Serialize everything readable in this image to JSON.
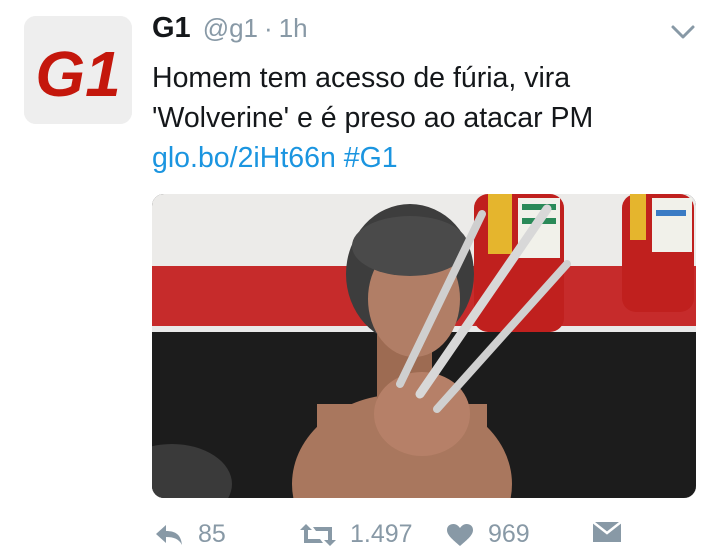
{
  "tweet": {
    "author_name": "G1",
    "author_handle": "@g1",
    "separator": "·",
    "timestamp": "1h",
    "text_line1": "Homem tem acesso de fúria, vira",
    "text_line2": "'Wolverine' e é preso ao atacar PM",
    "link": "glo.bo/2iHt66n",
    "hashtag": "#G1",
    "avatar_logo": "G1",
    "actions": {
      "reply_count": "85",
      "retweet_count": "1.497",
      "like_count": "969"
    }
  },
  "colors": {
    "logo_red": "#c4170c",
    "link_blue": "#1b95e0",
    "secondary_grey": "#8899a6"
  },
  "icons": [
    "g1-logo",
    "chevron-down-icon",
    "reply-icon",
    "retweet-icon",
    "heart-icon",
    "direct-message-icon"
  ]
}
